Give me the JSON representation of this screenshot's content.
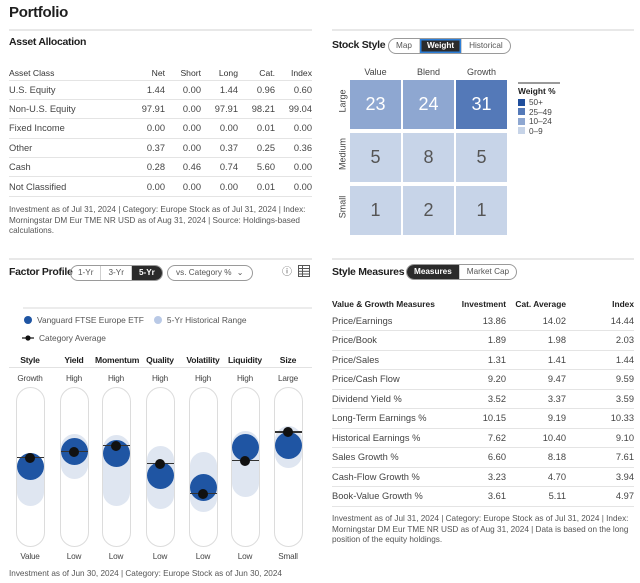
{
  "page": {
    "title": "Portfolio"
  },
  "asset_allocation": {
    "title": "Asset Allocation",
    "columns": [
      "Asset Class",
      "Net",
      "Short",
      "Long",
      "Cat.",
      "Index"
    ],
    "rows": [
      [
        "U.S. Equity",
        "1.44",
        "0.00",
        "1.44",
        "0.96",
        "0.60"
      ],
      [
        "Non-U.S. Equity",
        "97.91",
        "0.00",
        "97.91",
        "98.21",
        "99.04"
      ],
      [
        "Fixed Income",
        "0.00",
        "0.00",
        "0.00",
        "0.01",
        "0.00"
      ],
      [
        "Other",
        "0.37",
        "0.00",
        "0.37",
        "0.25",
        "0.36"
      ],
      [
        "Cash",
        "0.28",
        "0.46",
        "0.74",
        "5.60",
        "0.00"
      ],
      [
        "Not Classified",
        "0.00",
        "0.00",
        "0.00",
        "0.01",
        "0.00"
      ]
    ],
    "footnote": "Investment as of Jul 31, 2024 | Category: Europe Stock as of Jul 31, 2024 | Index: Morningstar DM Eur TME NR USD as of Aug 31, 2024 | Source: Holdings-based calculations."
  },
  "stock_style": {
    "title": "Stock Style",
    "tabs": [
      {
        "label": "Map",
        "active": false
      },
      {
        "label": "Weight",
        "active": true
      },
      {
        "label": "Historical",
        "active": false
      }
    ],
    "col_labels": [
      "Value",
      "Blend",
      "Growth"
    ],
    "row_labels": [
      "Large",
      "Medium",
      "Small"
    ],
    "grid": [
      [
        23,
        24,
        31
      ],
      [
        5,
        8,
        5
      ],
      [
        1,
        2,
        1
      ]
    ],
    "legend": {
      "title": "Weight %",
      "items": [
        {
          "label": "50+",
          "color": "#1f4e9c"
        },
        {
          "label": "25–49",
          "color": "#5479b8"
        },
        {
          "label": "10–24",
          "color": "#8ea7d1"
        },
        {
          "label": "0–9",
          "color": "#c7d4e8"
        }
      ]
    }
  },
  "factor_profile": {
    "title": "Factor Profile",
    "periods": [
      {
        "label": "1-Yr",
        "active": false
      },
      {
        "label": "3-Yr",
        "active": false
      },
      {
        "label": "5-Yr",
        "active": true
      }
    ],
    "comparison_select": {
      "value": "vs. Category %",
      "chevron": "⌄"
    },
    "info_icon": "ⓘ",
    "legend": {
      "fund": "Vanguard FTSE Europe ETF",
      "range": "5-Yr Historical Range",
      "category": "Category Average"
    },
    "factors": [
      {
        "name": "Style",
        "top": "Growth",
        "bottom": "Value",
        "fund_pct": 51,
        "category_pct": 57,
        "range_pct": [
          25,
          58
        ]
      },
      {
        "name": "Yield",
        "top": "High",
        "bottom": "Low",
        "fund_pct": 61,
        "category_pct": 61,
        "range_pct": [
          43,
          73
        ]
      },
      {
        "name": "Momentum",
        "top": "High",
        "bottom": "Low",
        "fund_pct": 60,
        "category_pct": 65,
        "range_pct": [
          25,
          72
        ]
      },
      {
        "name": "Quality",
        "top": "High",
        "bottom": "Low",
        "fund_pct": 45,
        "category_pct": 53,
        "range_pct": [
          23,
          65
        ]
      },
      {
        "name": "Volatility",
        "top": "High",
        "bottom": "Low",
        "fund_pct": 37,
        "category_pct": 33,
        "range_pct": [
          21,
          61
        ]
      },
      {
        "name": "Liquidity",
        "top": "High",
        "bottom": "Low",
        "fund_pct": 64,
        "category_pct": 55,
        "range_pct": [
          31,
          75
        ]
      },
      {
        "name": "Size",
        "top": "Large",
        "bottom": "Small",
        "fund_pct": 65,
        "category_pct": 74,
        "range_pct": [
          50,
          78
        ]
      }
    ],
    "footnote": "Investment as of Jun 30, 2024 | Category: Europe Stock as of Jun 30, 2024",
    "colors": {
      "fund": "#1f55a3",
      "range": "#dfe6f1",
      "category": "#111111"
    }
  },
  "style_measures": {
    "title": "Style Measures",
    "tabs": [
      {
        "label": "Measures",
        "active": true
      },
      {
        "label": "Market Cap",
        "active": false
      }
    ],
    "columns": [
      "Value & Growth Measures",
      "Investment",
      "Cat. Average",
      "Index"
    ],
    "rows": [
      [
        "Price/Earnings",
        "13.86",
        "14.02",
        "14.44"
      ],
      [
        "Price/Book",
        "1.89",
        "1.98",
        "2.03"
      ],
      [
        "Price/Sales",
        "1.31",
        "1.41",
        "1.44"
      ],
      [
        "Price/Cash Flow",
        "9.20",
        "9.47",
        "9.59"
      ],
      [
        "Dividend Yield %",
        "3.52",
        "3.37",
        "3.59"
      ],
      [
        "Long-Term Earnings %",
        "10.15",
        "9.19",
        "10.33"
      ],
      [
        "Historical Earnings %",
        "7.62",
        "10.40",
        "9.10"
      ],
      [
        "Sales Growth %",
        "6.60",
        "8.18",
        "7.61"
      ],
      [
        "Cash-Flow Growth %",
        "3.23",
        "4.70",
        "3.94"
      ],
      [
        "Book-Value Growth %",
        "3.61",
        "5.11",
        "4.97"
      ]
    ],
    "footnote": "Investment as of Jul 31, 2024 | Category: Europe Stock as of Jul 31, 2024 | Index: Morningstar DM Eur TME NR USD as of Aug 31, 2024 | Data is based on the long position of the equity holdings."
  }
}
